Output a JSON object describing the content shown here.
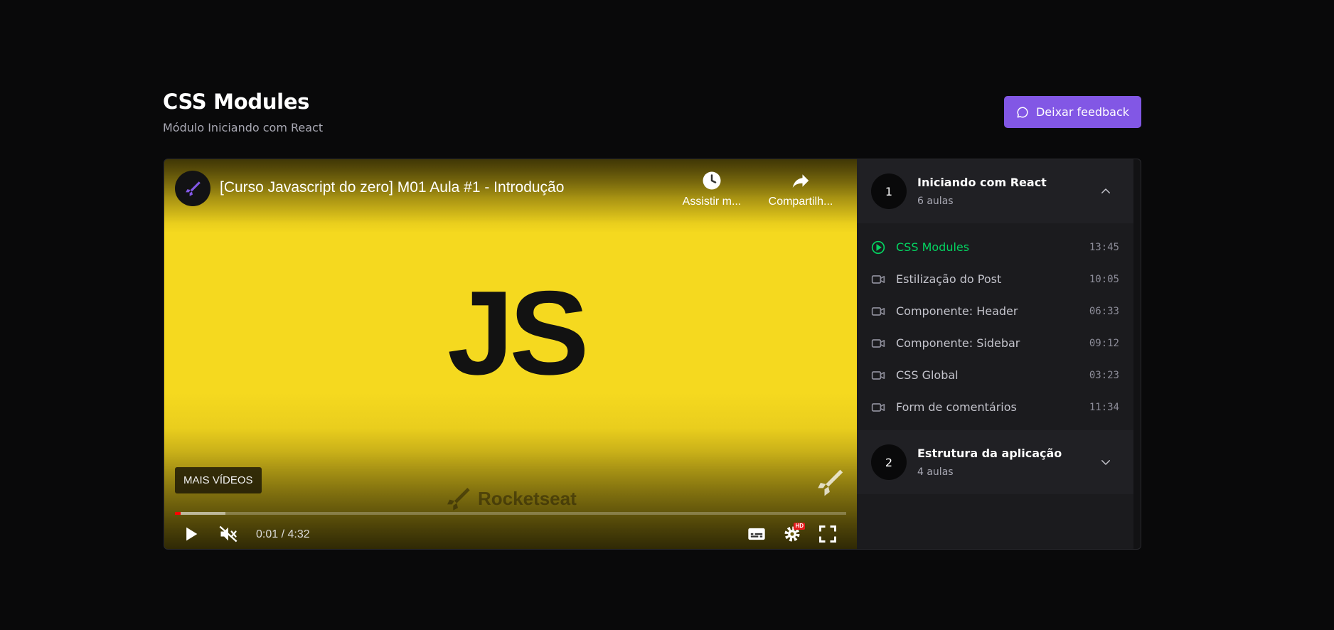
{
  "header": {
    "title": "CSS Modules",
    "subtitle": "Módulo Iniciando com React",
    "feedback_label": "Deixar feedback"
  },
  "player": {
    "video_title": "[Curso Javascript do zero] M01 Aula #1 - Introdução",
    "watch_later_label": "Assistir m...",
    "share_label": "Compartilh...",
    "logo_text": "JS",
    "more_videos_label": "MAIS VÍDEOS",
    "watermark_text": "Rocketseat",
    "time_display": "0:01 / 4:32",
    "played_fraction": 0.008,
    "buffered_fraction": 0.075,
    "hd_badge": "HD"
  },
  "modules": [
    {
      "number": "1",
      "title": "Iniciando com React",
      "count": "6 aulas",
      "expanded": true,
      "lessons": [
        {
          "name": "CSS Modules",
          "duration": "13:45",
          "active": true
        },
        {
          "name": "Estilização do Post",
          "duration": "10:05",
          "active": false
        },
        {
          "name": "Componente: Header",
          "duration": "06:33",
          "active": false
        },
        {
          "name": "Componente: Sidebar",
          "duration": "09:12",
          "active": false
        },
        {
          "name": "CSS Global",
          "duration": "03:23",
          "active": false
        },
        {
          "name": "Form de comentários",
          "duration": "11:34",
          "active": false
        }
      ]
    },
    {
      "number": "2",
      "title": "Estrutura da aplicação",
      "count": "4 aulas",
      "expanded": false
    }
  ],
  "colors": {
    "accent": "#8257e5",
    "active_lesson": "#04d361",
    "js_yellow": "#f5d91f",
    "progress_red": "#ff0000"
  }
}
